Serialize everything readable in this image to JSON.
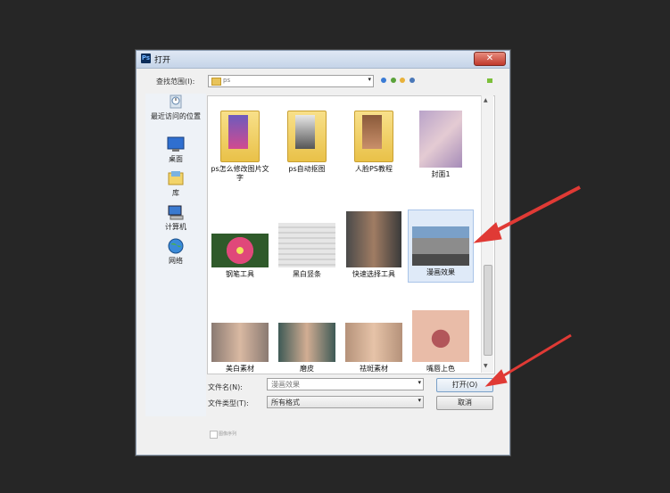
{
  "dialog": {
    "title": "打开",
    "logo": "Ps",
    "close": "✕"
  },
  "lookin": {
    "label": "查找范围(I):",
    "value": "ps",
    "arrow": "▾"
  },
  "places": [
    {
      "label": "最近访问的位置",
      "icon": "recent-places-icon"
    },
    {
      "label": "桌面",
      "icon": "desktop-icon"
    },
    {
      "label": "库",
      "icon": "libraries-icon"
    },
    {
      "label": "计算机",
      "icon": "computer-icon"
    },
    {
      "label": "网络",
      "icon": "network-icon"
    }
  ],
  "files": [
    {
      "label": "ps怎么修改图片文字",
      "kind": "folder"
    },
    {
      "label": "ps自动抠图",
      "kind": "folder"
    },
    {
      "label": "人脸PS教程",
      "kind": "folder"
    },
    {
      "label": "封面1",
      "kind": "image"
    },
    {
      "label": "钢笔工具",
      "kind": "image"
    },
    {
      "label": "黑白竖条",
      "kind": "image"
    },
    {
      "label": "快速选择工具",
      "kind": "image"
    },
    {
      "label": "漫画效果",
      "kind": "image",
      "selected": true
    },
    {
      "label": "美白素材",
      "kind": "image"
    },
    {
      "label": "磨皮",
      "kind": "image"
    },
    {
      "label": "祛斑素材",
      "kind": "image"
    },
    {
      "label": "嘴唇上色",
      "kind": "image"
    }
  ],
  "filename": {
    "label": "文件名(N):",
    "value": "漫画效果"
  },
  "filetype": {
    "label": "文件类型(T):",
    "value": "所有格式"
  },
  "buttons": {
    "open": "打开(O)",
    "cancel": "取消"
  },
  "checkbox_label": "图像序列",
  "colors": {
    "annotation_arrow": "#e03a35",
    "selection": "#dfeaf8"
  }
}
